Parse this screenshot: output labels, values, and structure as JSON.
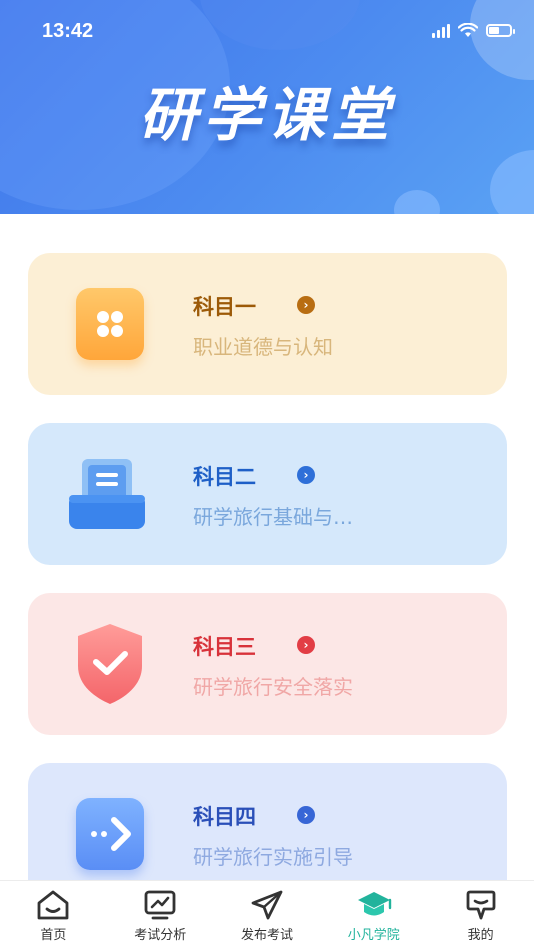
{
  "status_bar": {
    "time": "13:42"
  },
  "header": {
    "title": "研学课堂"
  },
  "subjects": [
    {
      "title": "科目一",
      "subtitle": "职业道德与认知",
      "icon": "grid-icon"
    },
    {
      "title": "科目二",
      "subtitle": "研学旅行基础与…",
      "icon": "document-tray-icon"
    },
    {
      "title": "科目三",
      "subtitle": "研学旅行安全落实",
      "icon": "shield-check-icon"
    },
    {
      "title": "科目四",
      "subtitle": "研学旅行实施引导",
      "icon": "arrow-right-icon"
    }
  ],
  "tabbar": {
    "active_color": "#22b39c",
    "items": [
      {
        "label": "首页",
        "icon": "home-icon"
      },
      {
        "label": "考试分析",
        "icon": "chart-trend-icon"
      },
      {
        "label": "发布考试",
        "icon": "paper-plane-icon"
      },
      {
        "label": "小凡学院",
        "icon": "graduation-cap-icon",
        "active": true
      },
      {
        "label": "我的",
        "icon": "profile-icon"
      }
    ]
  }
}
